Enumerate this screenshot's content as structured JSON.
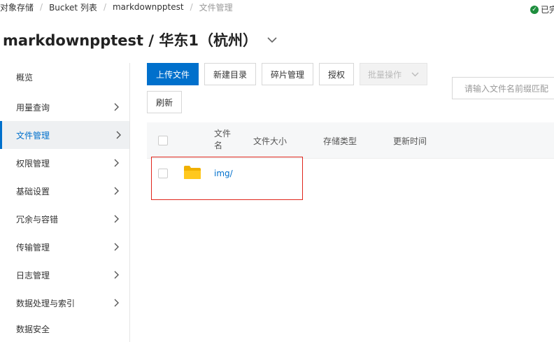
{
  "breadcrumb": {
    "items": [
      "对象存储",
      "Bucket 列表",
      "markdownpptest"
    ],
    "current": "文件管理"
  },
  "status": {
    "text": "已完"
  },
  "header": {
    "title": "markdownpptest / 华东1（杭州）"
  },
  "sidebar": {
    "items": [
      {
        "label": "概览"
      },
      {
        "label": "用量查询"
      },
      {
        "label": "文件管理"
      },
      {
        "label": "权限管理"
      },
      {
        "label": "基础设置"
      },
      {
        "label": "冗余与容错"
      },
      {
        "label": "传输管理"
      },
      {
        "label": "日志管理"
      },
      {
        "label": "数据处理与索引"
      },
      {
        "label": "数据安全"
      }
    ]
  },
  "toolbar": {
    "upload_label": "上传文件",
    "new_dir_label": "新建目录",
    "fragment_label": "碎片管理",
    "authorize_label": "授权",
    "batch_label": "批量操作",
    "refresh_label": "刷新",
    "search_placeholder": "请输入文件名前缀匹配"
  },
  "table": {
    "columns": [
      "文件名",
      "文件大小",
      "存储类型",
      "更新时间"
    ],
    "rows": [
      {
        "name": "img/",
        "size": "",
        "storage": "",
        "updated": ""
      }
    ]
  },
  "colors": {
    "accent": "#0070cc",
    "highlight": "#e0261c",
    "folder": "#f5b800"
  }
}
